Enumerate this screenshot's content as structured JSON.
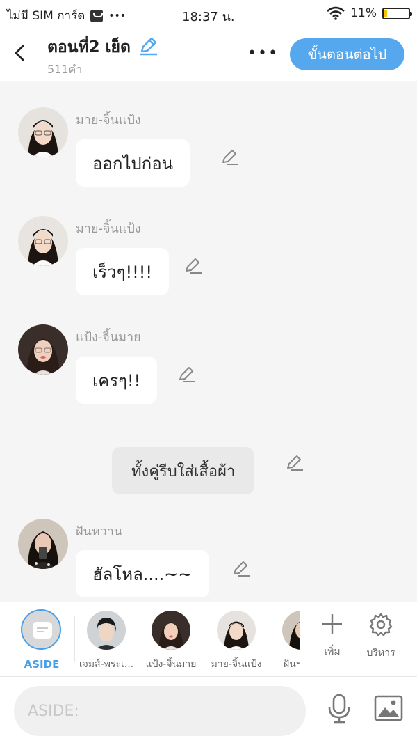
{
  "status_bar": {
    "carrier": "ไม่มี SIM การ์ด",
    "dots": "•••",
    "time": "18:37 น.",
    "battery_text": "11%",
    "battery_level": 0.11
  },
  "header": {
    "title": "ตอนที่2 เย็ด",
    "word_count": "511คำ",
    "more": "•••",
    "next_button": "ขั้นตอนต่อไป"
  },
  "messages": [
    {
      "sender": "มาย-จิ้นแป้ง",
      "text": "ออกไปก่อน"
    },
    {
      "sender": "มาย-จิ้นแป้ง",
      "text": "เร็วๆ!!!!"
    },
    {
      "sender": "แป้ง-จิ้นมาย",
      "text": "เครๆ!!"
    },
    {
      "narration": "ทั้งคู่รีบใส่เสื้อผ้า"
    },
    {
      "sender": "ฝันหวาน",
      "text": "ฮัลโหล....~~"
    }
  ],
  "character_bar": {
    "aside_label": "ASIDE",
    "characters": [
      {
        "name": "เจมส์-พระเ..."
      },
      {
        "name": "แป้ง-จิ้นมาย"
      },
      {
        "name": "มาย-จิ้นแป้ง"
      },
      {
        "name": "ฝันฯ"
      }
    ],
    "add_label": "เพิ่ม",
    "manage_label": "บริหาร"
  },
  "composer": {
    "placeholder": "ASIDE:"
  },
  "colors": {
    "accent": "#56a8ee",
    "background": "#f5f5f5",
    "battery": "#f5c400"
  }
}
